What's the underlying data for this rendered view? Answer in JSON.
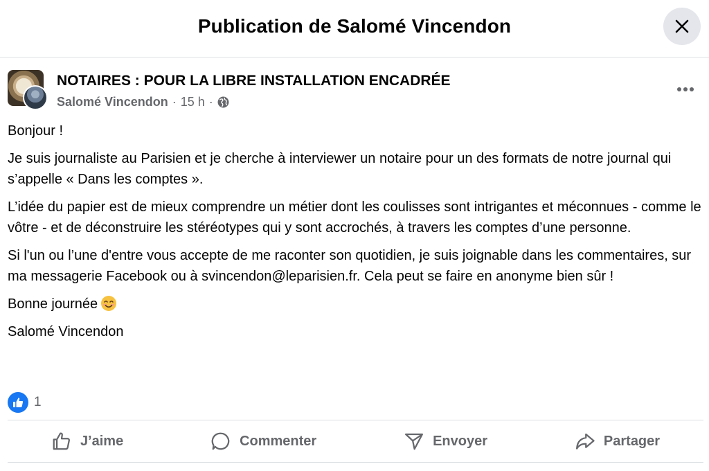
{
  "header": {
    "title": "Publication de Salomé Vincendon",
    "close_icon": "close-icon"
  },
  "post": {
    "group_name": "NOTAIRES : POUR LA LIBRE INSTALLATION ENCADRÉE",
    "author": "Salomé Vincendon",
    "time": "15 h",
    "separator": "·",
    "visibility_icon": "globe-icon",
    "more_icon": "more-options-icon",
    "paragraphs": [
      "Bonjour !",
      "Je suis journaliste au Parisien et je cherche à interviewer un notaire pour un des formats de notre journal qui s’appelle « Dans les comptes ».",
      "L’idée du papier est de mieux comprendre un métier dont les coulisses sont intrigantes et méconnues - comme le vôtre - et de déconstruire les stéréotypes qui y sont accrochés, à travers les comptes d’une personne.",
      "Si l'un ou l’une d'entre vous accepte de me raconter son quotidien, je suis joignable dans les commentaires, sur ma messagerie Facebook ou à svincendon@leparisien.fr. Cela peut se faire en anonyme bien sûr !",
      "Bonne journée",
      "Salomé Vincendon"
    ],
    "reactions": {
      "icon": "like-reaction-icon",
      "count": "1"
    }
  },
  "actions": [
    {
      "label": "J’aime",
      "icon": "like-icon"
    },
    {
      "label": "Commenter",
      "icon": "comment-icon"
    },
    {
      "label": "Envoyer",
      "icon": "send-icon"
    },
    {
      "label": "Partager",
      "icon": "share-icon"
    }
  ],
  "colors": {
    "accent": "#1877f2",
    "secondary_text": "#65676b",
    "divider": "#dcdfe3"
  }
}
